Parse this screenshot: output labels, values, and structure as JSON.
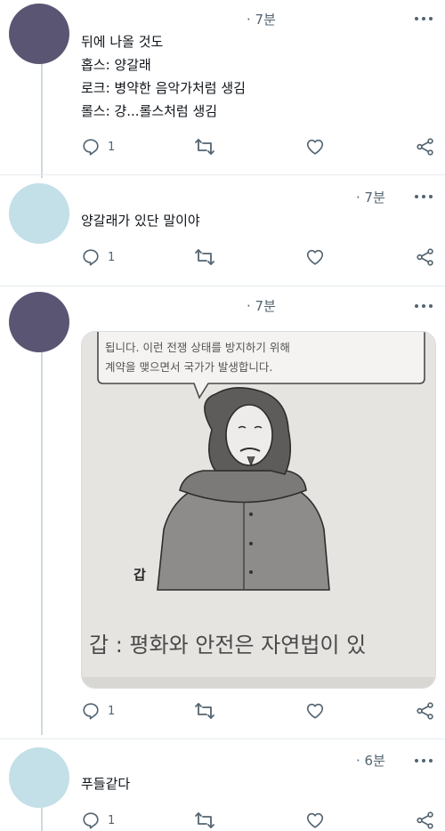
{
  "tweets": [
    {
      "time": "· 7분",
      "text": "뒤에 나올 것도\n홉스: 양갈래\n로크: 병약한 음악가처럼 생김\n롤스: 걍...롤스처럼 생김",
      "reply_count": "1",
      "avatar_color": "#5a5573"
    },
    {
      "time": "· 7분",
      "text": "양갈래가 있단 말이야",
      "reply_count": "1",
      "avatar_color": "#c3dfe8"
    },
    {
      "time": "· 7분",
      "text": "",
      "reply_count": "1",
      "avatar_color": "#5a5573",
      "media": {
        "bubble_line1": "됩니다. 이런 전쟁 상태를 방지하기 위해",
        "bubble_line2": "계약을 맺으면서 국가가 발생합니다.",
        "caption_label": "갑",
        "bottom_text": "갑 : 평화와 안전은 자연법이 있"
      }
    },
    {
      "time": "· 6분",
      "text": "푸들같다",
      "reply_count": "1",
      "avatar_color": "#c3dfe8"
    }
  ],
  "icons": [
    "reply-icon",
    "retweet-icon",
    "like-icon",
    "share-icon",
    "more-icon"
  ],
  "colors": {
    "icon_gray": "#536471",
    "thread_line": "#cfd9de",
    "text": "#0f1419"
  }
}
